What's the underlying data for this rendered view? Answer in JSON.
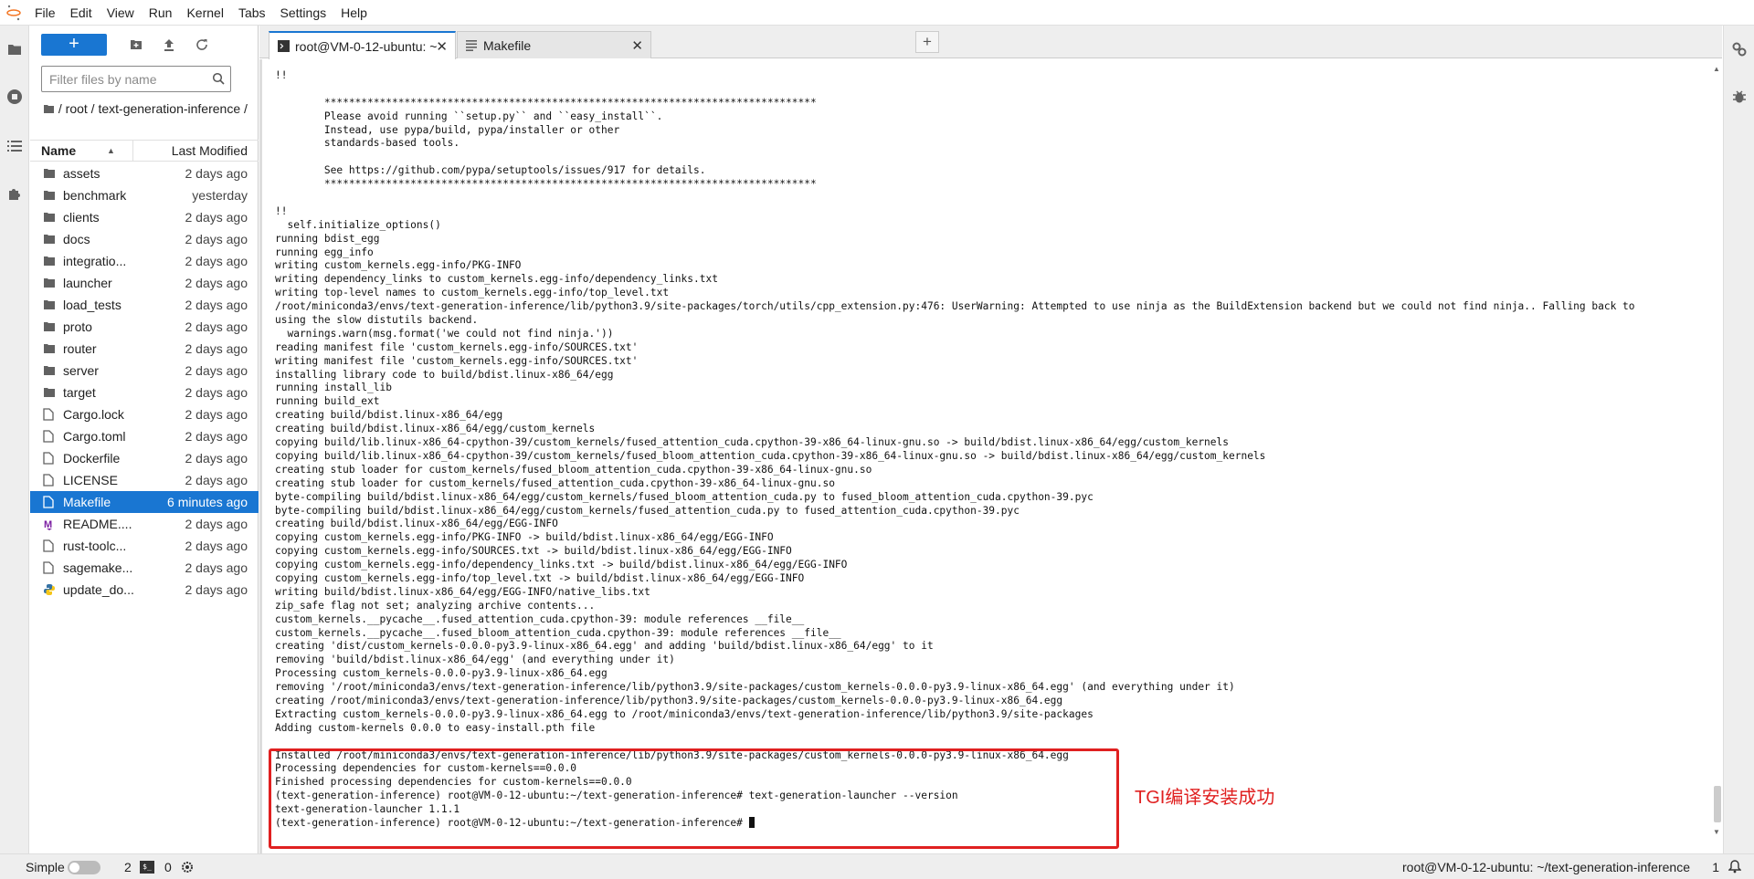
{
  "menubar": {
    "items": [
      "File",
      "Edit",
      "View",
      "Run",
      "Kernel",
      "Tabs",
      "Settings",
      "Help"
    ]
  },
  "filebrowser": {
    "new_button": "+",
    "search_placeholder": "Filter files by name",
    "path": "/ root / text-generation-inference /",
    "col_name": "Name",
    "col_modified": "Last Modified",
    "files": [
      {
        "name": "assets",
        "modified": "2 days ago",
        "type": "folder"
      },
      {
        "name": "benchmark",
        "modified": "yesterday",
        "type": "folder"
      },
      {
        "name": "clients",
        "modified": "2 days ago",
        "type": "folder"
      },
      {
        "name": "docs",
        "modified": "2 days ago",
        "type": "folder"
      },
      {
        "name": "integratio...",
        "modified": "2 days ago",
        "type": "folder"
      },
      {
        "name": "launcher",
        "modified": "2 days ago",
        "type": "folder"
      },
      {
        "name": "load_tests",
        "modified": "2 days ago",
        "type": "folder"
      },
      {
        "name": "proto",
        "modified": "2 days ago",
        "type": "folder"
      },
      {
        "name": "router",
        "modified": "2 days ago",
        "type": "folder"
      },
      {
        "name": "server",
        "modified": "2 days ago",
        "type": "folder"
      },
      {
        "name": "target",
        "modified": "2 days ago",
        "type": "folder"
      },
      {
        "name": "Cargo.lock",
        "modified": "2 days ago",
        "type": "file"
      },
      {
        "name": "Cargo.toml",
        "modified": "2 days ago",
        "type": "file"
      },
      {
        "name": "Dockerfile",
        "modified": "2 days ago",
        "type": "file"
      },
      {
        "name": "LICENSE",
        "modified": "2 days ago",
        "type": "file"
      },
      {
        "name": "Makefile",
        "modified": "6 minutes ago",
        "type": "file",
        "selected": true
      },
      {
        "name": "README....",
        "modified": "2 days ago",
        "type": "markdown"
      },
      {
        "name": "rust-toolc...",
        "modified": "2 days ago",
        "type": "file"
      },
      {
        "name": "sagemake...",
        "modified": "2 days ago",
        "type": "file"
      },
      {
        "name": "update_do...",
        "modified": "2 days ago",
        "type": "python"
      }
    ]
  },
  "tabs": [
    {
      "label": "root@VM-0-12-ubuntu: ~",
      "icon": "terminal-icon",
      "active": true
    },
    {
      "label": "Makefile",
      "icon": "text-file-icon",
      "active": false
    }
  ],
  "terminal": {
    "lines": [
      "!!",
      "",
      "        ********************************************************************************",
      "        Please avoid running ``setup.py`` and ``easy_install``.",
      "        Instead, use pypa/build, pypa/installer or other",
      "        standards-based tools.",
      "",
      "        See https://github.com/pypa/setuptools/issues/917 for details.",
      "        ********************************************************************************",
      "",
      "!!",
      "  self.initialize_options()",
      "running bdist_egg",
      "running egg_info",
      "writing custom_kernels.egg-info/PKG-INFO",
      "writing dependency_links to custom_kernels.egg-info/dependency_links.txt",
      "writing top-level names to custom_kernels.egg-info/top_level.txt",
      "/root/miniconda3/envs/text-generation-inference/lib/python3.9/site-packages/torch/utils/cpp_extension.py:476: UserWarning: Attempted to use ninja as the BuildExtension backend but we could not find ninja.. Falling back to",
      "using the slow distutils backend.",
      "  warnings.warn(msg.format('we could not find ninja.'))",
      "reading manifest file 'custom_kernels.egg-info/SOURCES.txt'",
      "writing manifest file 'custom_kernels.egg-info/SOURCES.txt'",
      "installing library code to build/bdist.linux-x86_64/egg",
      "running install_lib",
      "running build_ext",
      "creating build/bdist.linux-x86_64/egg",
      "creating build/bdist.linux-x86_64/egg/custom_kernels",
      "copying build/lib.linux-x86_64-cpython-39/custom_kernels/fused_attention_cuda.cpython-39-x86_64-linux-gnu.so -> build/bdist.linux-x86_64/egg/custom_kernels",
      "copying build/lib.linux-x86_64-cpython-39/custom_kernels/fused_bloom_attention_cuda.cpython-39-x86_64-linux-gnu.so -> build/bdist.linux-x86_64/egg/custom_kernels",
      "creating stub loader for custom_kernels/fused_bloom_attention_cuda.cpython-39-x86_64-linux-gnu.so",
      "creating stub loader for custom_kernels/fused_attention_cuda.cpython-39-x86_64-linux-gnu.so",
      "byte-compiling build/bdist.linux-x86_64/egg/custom_kernels/fused_bloom_attention_cuda.py to fused_bloom_attention_cuda.cpython-39.pyc",
      "byte-compiling build/bdist.linux-x86_64/egg/custom_kernels/fused_attention_cuda.py to fused_attention_cuda.cpython-39.pyc",
      "creating build/bdist.linux-x86_64/egg/EGG-INFO",
      "copying custom_kernels.egg-info/PKG-INFO -> build/bdist.linux-x86_64/egg/EGG-INFO",
      "copying custom_kernels.egg-info/SOURCES.txt -> build/bdist.linux-x86_64/egg/EGG-INFO",
      "copying custom_kernels.egg-info/dependency_links.txt -> build/bdist.linux-x86_64/egg/EGG-INFO",
      "copying custom_kernels.egg-info/top_level.txt -> build/bdist.linux-x86_64/egg/EGG-INFO",
      "writing build/bdist.linux-x86_64/egg/EGG-INFO/native_libs.txt",
      "zip_safe flag not set; analyzing archive contents...",
      "custom_kernels.__pycache__.fused_attention_cuda.cpython-39: module references __file__",
      "custom_kernels.__pycache__.fused_bloom_attention_cuda.cpython-39: module references __file__",
      "creating 'dist/custom_kernels-0.0.0-py3.9-linux-x86_64.egg' and adding 'build/bdist.linux-x86_64/egg' to it",
      "removing 'build/bdist.linux-x86_64/egg' (and everything under it)",
      "Processing custom_kernels-0.0.0-py3.9-linux-x86_64.egg",
      "removing '/root/miniconda3/envs/text-generation-inference/lib/python3.9/site-packages/custom_kernels-0.0.0-py3.9-linux-x86_64.egg' (and everything under it)",
      "creating /root/miniconda3/envs/text-generation-inference/lib/python3.9/site-packages/custom_kernels-0.0.0-py3.9-linux-x86_64.egg",
      "Extracting custom_kernels-0.0.0-py3.9-linux-x86_64.egg to /root/miniconda3/envs/text-generation-inference/lib/python3.9/site-packages",
      "Adding custom-kernels 0.0.0 to easy-install.pth file",
      "",
      "Installed /root/miniconda3/envs/text-generation-inference/lib/python3.9/site-packages/custom_kernels-0.0.0-py3.9-linux-x86_64.egg",
      "Processing dependencies for custom-kernels==0.0.0",
      "Finished processing dependencies for custom-kernels==0.0.0",
      "(text-generation-inference) root@VM-0-12-ubuntu:~/text-generation-inference# text-generation-launcher --version",
      "text-generation-launcher 1.1.1"
    ],
    "prompt": "(text-generation-inference) root@VM-0-12-ubuntu:~/text-generation-inference# "
  },
  "annotation": {
    "text": "TGI编译安装成功",
    "color": "#e02020"
  },
  "statusbar": {
    "mode_label": "Simple",
    "terminals_count": "2",
    "kernels_count": "0",
    "path": "root@VM-0-12-ubuntu: ~/text-generation-inference",
    "num": "1"
  },
  "colors": {
    "accent": "#1976d2",
    "highlight": "#e02020"
  }
}
